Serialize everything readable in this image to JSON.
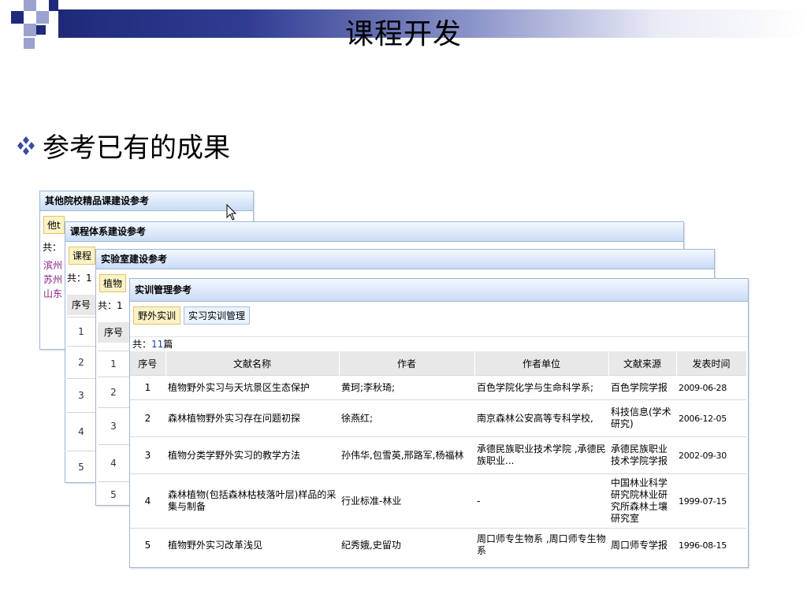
{
  "slide": {
    "title": "课程开发",
    "bullet": "参考已有的成果",
    "bullet_icon": "four-diamond-bullet-icon"
  },
  "panels": {
    "p1": {
      "title": "其他院校精品课建设参考",
      "tab": "他t",
      "count": "共：",
      "links": [
        "滨州",
        "苏州",
        "山东"
      ]
    },
    "p2": {
      "title": "课程体系建设参考",
      "tab": "课程",
      "count": "共：1",
      "header": "序号",
      "rows": [
        "1",
        "2",
        "3",
        "4",
        "5"
      ]
    },
    "p3": {
      "title": "实验室建设参考",
      "tab": "植物",
      "count": "共：1",
      "header": "序号",
      "rows": [
        "1",
        "2",
        "3",
        "4",
        "5"
      ]
    },
    "p4": {
      "title": "实训管理参考",
      "tabs": [
        "野外实训",
        "实习实训管理"
      ],
      "count_prefix": "共：",
      "count_num": "11",
      "count_suffix": "篇",
      "columns": [
        "序号",
        "文献名称",
        "作者",
        "作者单位",
        "文献来源",
        "发表时间"
      ],
      "rows": [
        {
          "no": "1",
          "title": "植物野外实习与天坑景区生态保护",
          "author": "黄珂;李秋琦;",
          "unit": "百色学院化学与生命科学系;",
          "source": "百色学院学报",
          "date": "2009-06-28"
        },
        {
          "no": "2",
          "title": "森林植物野外实习存在问题初探",
          "author": "徐燕红;",
          "unit": "南京森林公安高等专科学校,",
          "source": "科技信息(学术研究)",
          "date": "2006-12-05"
        },
        {
          "no": "3",
          "title": "植物分类学野外实习的教学方法",
          "author": "孙伟华,包雪英,邢路军,杨福林",
          "unit": "承德民族职业技术学院 ,承德民族职业...",
          "source": "承德民族职业技术学院学报",
          "date": "2002-09-30"
        },
        {
          "no": "4",
          "title": "森林植物(包括森林枯枝落叶层)样品的采集与制备",
          "author": "行业标准-林业",
          "unit": "-",
          "source": "中国林业科学研究院林业研究所森林土壤研究室",
          "date": "1999-07-15"
        },
        {
          "no": "5",
          "title": "植物野外实习改革浅见",
          "author": "纪秀娥,史留功",
          "unit": "周口师专生物系 ,周口师专生物系",
          "source": "周口师专学报",
          "date": "1996-08-15"
        }
      ]
    }
  },
  "colors": {
    "header_navy": "#1e2a78",
    "link_blue": "#1f3fa6",
    "active_tab": "#fbf3c6"
  }
}
